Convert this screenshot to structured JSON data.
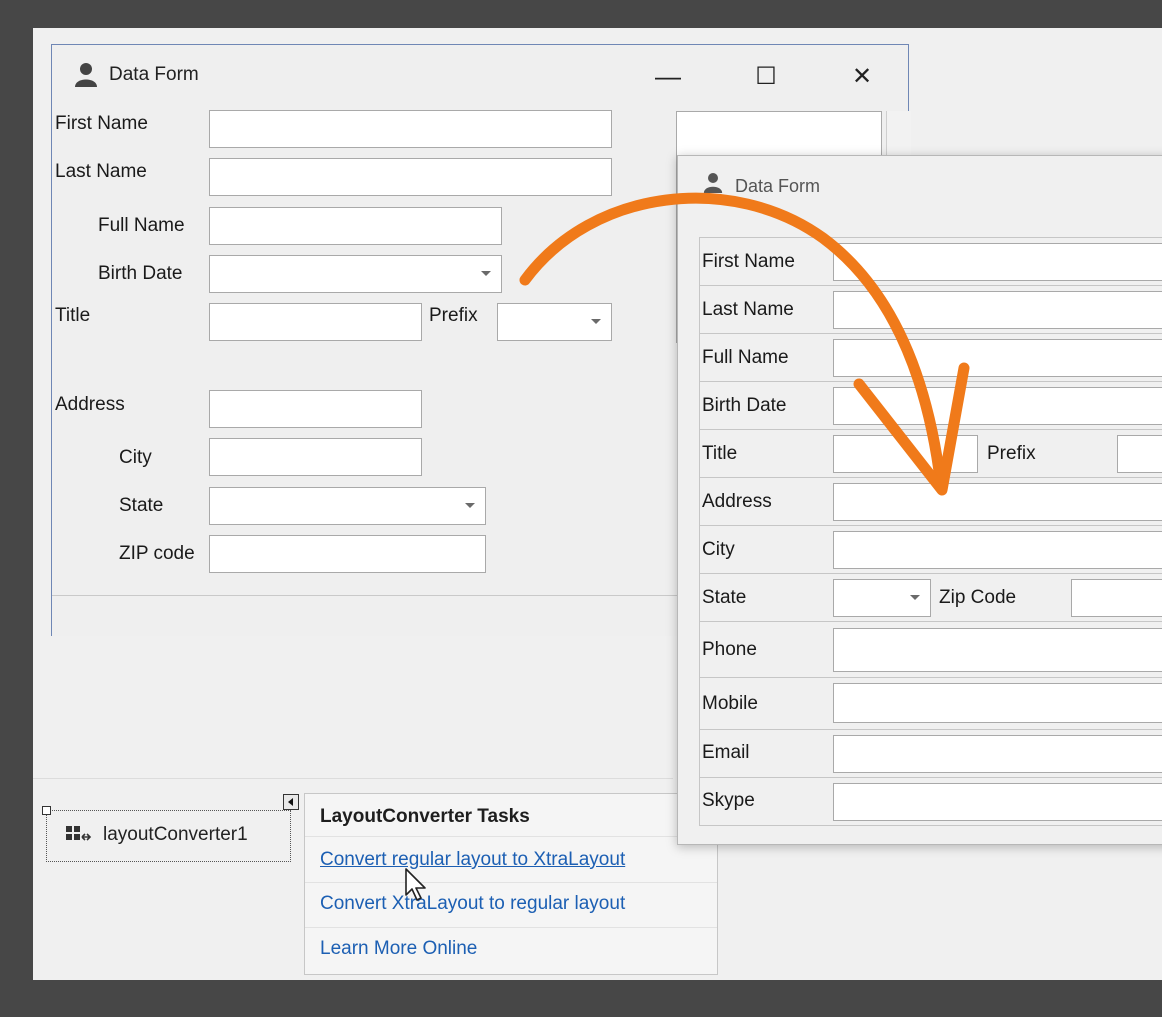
{
  "colors": {
    "accent_arrow": "#f07a1a",
    "link": "#1c5fb3",
    "window_border": "#6f87b5"
  },
  "window1": {
    "title": "Data Form",
    "icon": "user-icon",
    "controls": {
      "minimize": "—",
      "maximize": "☐",
      "close": "✕"
    },
    "labels": {
      "first_name": "First Name",
      "last_name": "Last Name",
      "full_name": "Full Name",
      "birth_date": "Birth Date",
      "title": "Title",
      "prefix": "Prefix",
      "address": "Address",
      "city": "City",
      "state": "State",
      "zip": "ZIP code"
    }
  },
  "window2": {
    "title": "Data Form",
    "icon": "user-icon",
    "labels": {
      "first_name": "First Name",
      "last_name": "Last Name",
      "full_name": "Full Name",
      "birth_date": "Birth Date",
      "title": "Title",
      "prefix": "Prefix",
      "address": "Address",
      "city": "City",
      "state": "State",
      "zip": "Zip Code",
      "phone": "Phone",
      "mobile": "Mobile",
      "email": "Email",
      "skype": "Skype"
    }
  },
  "component": {
    "name": "layoutConverter1",
    "icon": "layout-converter-icon"
  },
  "tasks": {
    "heading": "LayoutConverter Tasks",
    "items": [
      "Convert regular layout to XtraLayout",
      "Convert XtraLayout to regular layout",
      "Learn More Online"
    ]
  }
}
